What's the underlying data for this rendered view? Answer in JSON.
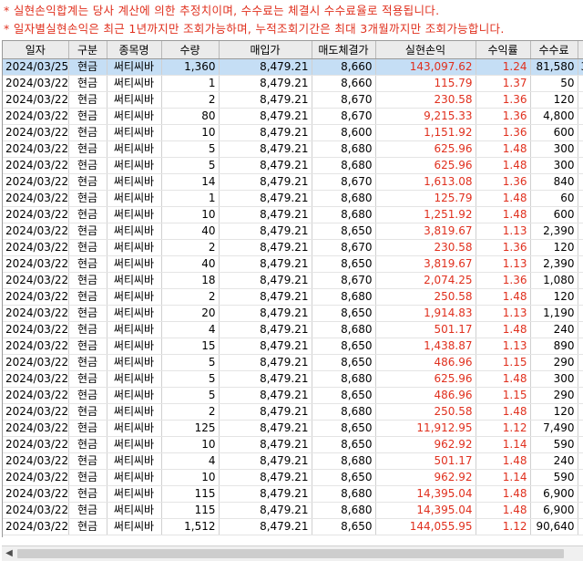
{
  "notes": [
    "* 실현손익합계는 당사 계산에 의한 추정치이며, 수수료는 체결시 수수료율로 적용됩니다.",
    "* 일자별실현손익은 최근 1년까지만 조회가능하며, 누적조회기간은 최대 3개월까지만 조회가능합니다."
  ],
  "columns": [
    "일자",
    "구분",
    "종목명",
    "수량",
    "매입가",
    "매도체결가",
    "실현손익",
    "수익률",
    "수수료"
  ],
  "selected_row": 0,
  "first_row_overflow": "3",
  "rows": [
    [
      "2024/03/25",
      "현금",
      "써티씨바",
      "1,360",
      "8,479.21",
      "8,660",
      "143,097.62",
      "1.24",
      "81,580"
    ],
    [
      "2024/03/22",
      "현금",
      "써티씨바",
      "1",
      "8,479.21",
      "8,660",
      "115.79",
      "1.37",
      "50"
    ],
    [
      "2024/03/22",
      "현금",
      "써티씨바",
      "2",
      "8,479.21",
      "8,670",
      "230.58",
      "1.36",
      "120"
    ],
    [
      "2024/03/22",
      "현금",
      "써티씨바",
      "80",
      "8,479.21",
      "8,670",
      "9,215.33",
      "1.36",
      "4,800"
    ],
    [
      "2024/03/22",
      "현금",
      "써티씨바",
      "10",
      "8,479.21",
      "8,600",
      "1,151.92",
      "1.36",
      "600"
    ],
    [
      "2024/03/22",
      "현금",
      "써티씨바",
      "5",
      "8,479.21",
      "8,680",
      "625.96",
      "1.48",
      "300"
    ],
    [
      "2024/03/22",
      "현금",
      "써티씨바",
      "5",
      "8,479.21",
      "8,680",
      "625.96",
      "1.48",
      "300"
    ],
    [
      "2024/03/22",
      "현금",
      "써티씨바",
      "14",
      "8,479.21",
      "8,670",
      "1,613.08",
      "1.36",
      "840"
    ],
    [
      "2024/03/22",
      "현금",
      "써티씨바",
      "1",
      "8,479.21",
      "8,680",
      "125.79",
      "1.48",
      "60"
    ],
    [
      "2024/03/22",
      "현금",
      "써티씨바",
      "10",
      "8,479.21",
      "8,680",
      "1,251.92",
      "1.48",
      "600"
    ],
    [
      "2024/03/22",
      "현금",
      "써티씨바",
      "40",
      "8,479.21",
      "8,650",
      "3,819.67",
      "1.13",
      "2,390"
    ],
    [
      "2024/03/22",
      "현금",
      "써티씨바",
      "2",
      "8,479.21",
      "8,670",
      "230.58",
      "1.36",
      "120"
    ],
    [
      "2024/03/22",
      "현금",
      "써티씨바",
      "40",
      "8,479.21",
      "8,650",
      "3,819.67",
      "1.13",
      "2,390"
    ],
    [
      "2024/03/22",
      "현금",
      "써티씨바",
      "18",
      "8,479.21",
      "8,670",
      "2,074.25",
      "1.36",
      "1,080"
    ],
    [
      "2024/03/22",
      "현금",
      "써티씨바",
      "2",
      "8,479.21",
      "8,680",
      "250.58",
      "1.48",
      "120"
    ],
    [
      "2024/03/22",
      "현금",
      "써티씨바",
      "20",
      "8,479.21",
      "8,650",
      "1,914.83",
      "1.13",
      "1,190"
    ],
    [
      "2024/03/22",
      "현금",
      "써티씨바",
      "4",
      "8,479.21",
      "8,680",
      "501.17",
      "1.48",
      "240"
    ],
    [
      "2024/03/22",
      "현금",
      "써티씨바",
      "15",
      "8,479.21",
      "8,650",
      "1,438.87",
      "1.13",
      "890"
    ],
    [
      "2024/03/22",
      "현금",
      "써티씨바",
      "5",
      "8,479.21",
      "8,650",
      "486.96",
      "1.15",
      "290"
    ],
    [
      "2024/03/22",
      "현금",
      "써티씨바",
      "5",
      "8,479.21",
      "8,680",
      "625.96",
      "1.48",
      "300"
    ],
    [
      "2024/03/22",
      "현금",
      "써티씨바",
      "5",
      "8,479.21",
      "8,650",
      "486.96",
      "1.15",
      "290"
    ],
    [
      "2024/03/22",
      "현금",
      "써티씨바",
      "2",
      "8,479.21",
      "8,680",
      "250.58",
      "1.48",
      "120"
    ],
    [
      "2024/03/22",
      "현금",
      "써티씨바",
      "125",
      "8,479.21",
      "8,650",
      "11,912.95",
      "1.12",
      "7,490"
    ],
    [
      "2024/03/22",
      "현금",
      "써티씨바",
      "10",
      "8,479.21",
      "8,650",
      "962.92",
      "1.14",
      "590"
    ],
    [
      "2024/03/22",
      "현금",
      "써티씨바",
      "4",
      "8,479.21",
      "8,680",
      "501.17",
      "1.48",
      "240"
    ],
    [
      "2024/03/22",
      "현금",
      "써티씨바",
      "10",
      "8,479.21",
      "8,650",
      "962.92",
      "1.14",
      "590"
    ],
    [
      "2024/03/22",
      "현금",
      "써티씨바",
      "115",
      "8,479.21",
      "8,680",
      "14,395.04",
      "1.48",
      "6,900"
    ],
    [
      "2024/03/22",
      "현금",
      "써티씨바",
      "115",
      "8,479.21",
      "8,680",
      "14,395.04",
      "1.48",
      "6,900"
    ],
    [
      "2024/03/22",
      "현금",
      "써티씨바",
      "1,512",
      "8,479.21",
      "8,650",
      "144,055.95",
      "1.12",
      "90,640"
    ]
  ],
  "scrollbar": {
    "left_arrow_icon": "chevron-left-icon"
  },
  "colors": {
    "note_text": "#e0301e",
    "pnl_text": "#e0301e",
    "selected_row_bg": "#c5def5",
    "header_bg": "#ebebeb"
  }
}
